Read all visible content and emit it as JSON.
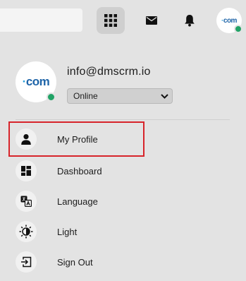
{
  "header": {
    "avatar_logo_text": "·com",
    "apps_icon": "grid-icon",
    "mail_icon": "mail-icon",
    "notification_icon": "bell-icon"
  },
  "profile": {
    "avatar_logo_text": "·com",
    "email": "info@dmscrm.io",
    "status_value": "Online",
    "status_color": "#21a366"
  },
  "menu": {
    "items": [
      {
        "label": "My Profile",
        "icon": "user-icon",
        "highlighted": true
      },
      {
        "label": "Dashboard",
        "icon": "dashboard-icon"
      },
      {
        "label": "Language",
        "icon": "translate-icon"
      },
      {
        "label": "Light",
        "icon": "theme-icon"
      },
      {
        "label": "Sign Out",
        "icon": "sign-out-icon"
      }
    ]
  },
  "colors": {
    "background": "#e3e3e3",
    "highlight_border": "#d7242a",
    "logo_blue": "#1e64a8"
  }
}
